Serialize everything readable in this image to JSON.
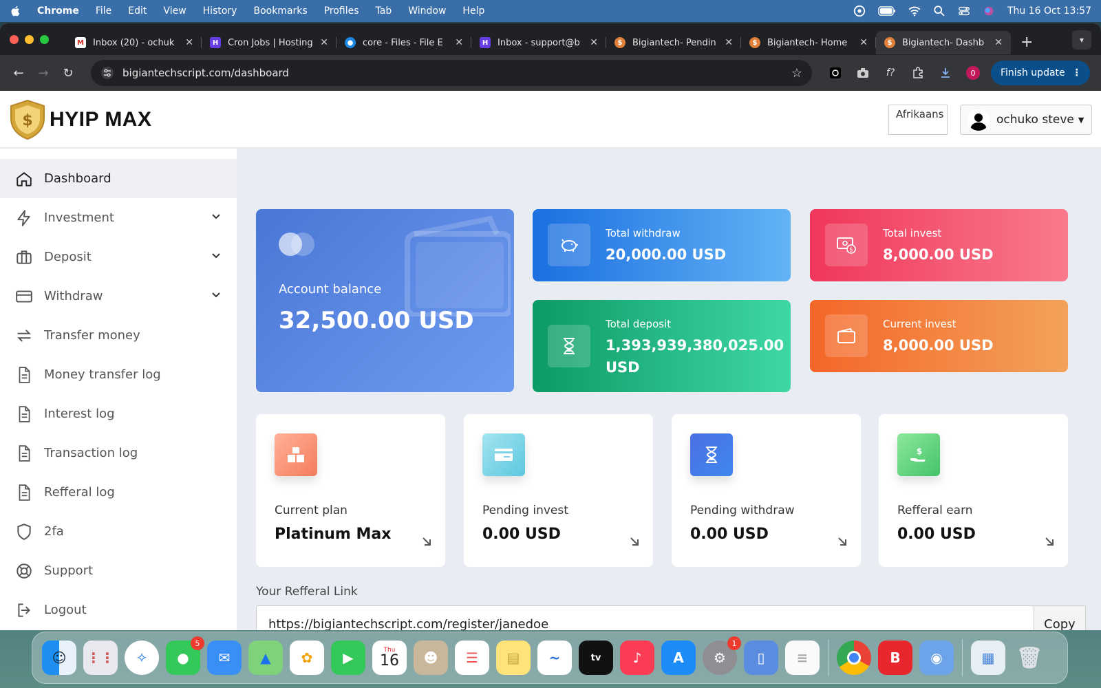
{
  "menubar": {
    "app": "Chrome",
    "items": [
      "File",
      "Edit",
      "View",
      "History",
      "Bookmarks",
      "Profiles",
      "Tab",
      "Window",
      "Help"
    ],
    "datetime": "Thu 16 Oct  13:57"
  },
  "tabs": [
    {
      "title": "Inbox (20) - ochuk",
      "favicon": "gmail-icon",
      "color": "#ffffff"
    },
    {
      "title": "Cron Jobs | Hosting",
      "favicon": "hostinger-icon",
      "color": "#673de6"
    },
    {
      "title": "core - Files - File E",
      "favicon": "file-manager-icon",
      "color": "#1e88e5"
    },
    {
      "title": "Inbox - support@b",
      "favicon": "hostinger-icon",
      "color": "#673de6"
    },
    {
      "title": "Bigiantech- Pendin",
      "favicon": "site-icon",
      "color": "#e0803a"
    },
    {
      "title": "Bigiantech- Home",
      "favicon": "site-icon",
      "color": "#e0803a"
    },
    {
      "title": "Bigiantech- Dashb",
      "favicon": "site-icon",
      "color": "#e0803a"
    }
  ],
  "toolbar": {
    "url": "bigiantechscript.com/dashboard",
    "finish_update": "Finish update",
    "ext_badge": "0"
  },
  "header": {
    "logo_text": "HYIP MAX",
    "language": "Afrikaans",
    "user": "ochuko steve"
  },
  "sidebar": {
    "items": [
      {
        "label": "Dashboard",
        "icon": "home-icon"
      },
      {
        "label": "Investment",
        "icon": "bolt-icon",
        "dropdown": true
      },
      {
        "label": "Deposit",
        "icon": "briefcase-icon",
        "dropdown": true
      },
      {
        "label": "Withdraw",
        "icon": "credit-card-icon",
        "dropdown": true
      },
      {
        "label": "Transfer money",
        "icon": "transfer-icon"
      },
      {
        "label": "Money transfer log",
        "icon": "document-icon"
      },
      {
        "label": "Interest log",
        "icon": "document-icon"
      },
      {
        "label": "Transaction log",
        "icon": "document-icon"
      },
      {
        "label": "Refferal log",
        "icon": "document-icon"
      },
      {
        "label": "2fa",
        "icon": "shield-icon"
      },
      {
        "label": "Support",
        "icon": "lifebuoy-icon"
      },
      {
        "label": "Logout",
        "icon": "logout-icon"
      }
    ]
  },
  "balance": {
    "label": "Account balance",
    "value": "32,500.00 USD"
  },
  "stats": {
    "total_withdraw": {
      "label": "Total withdraw",
      "value": "20,000.00 USD"
    },
    "total_invest": {
      "label": "Total invest",
      "value": "8,000.00 USD"
    },
    "total_deposit": {
      "label": "Total deposit",
      "value": "1,393,939,380,025.00 USD"
    },
    "current_invest": {
      "label": "Current invest",
      "value": "8,000.00 USD"
    }
  },
  "mini": {
    "current_plan": {
      "label": "Current plan",
      "value": "Platinum Max"
    },
    "pending_invest": {
      "label": "Pending invest",
      "value": "0.00 USD"
    },
    "pending_withdraw": {
      "label": "Pending withdraw",
      "value": "0.00 USD"
    },
    "referral_earn": {
      "label": "Refferal earn",
      "value": "0.00 USD"
    }
  },
  "referral": {
    "label": "Your Refferal Link",
    "url": "https://bigiantechscript.com/register/janedoe",
    "copy": "Copy"
  },
  "dock": {
    "calendar_month": "Thu",
    "calendar_day": "16",
    "messages_badge": "5",
    "settings_badge": "1"
  }
}
